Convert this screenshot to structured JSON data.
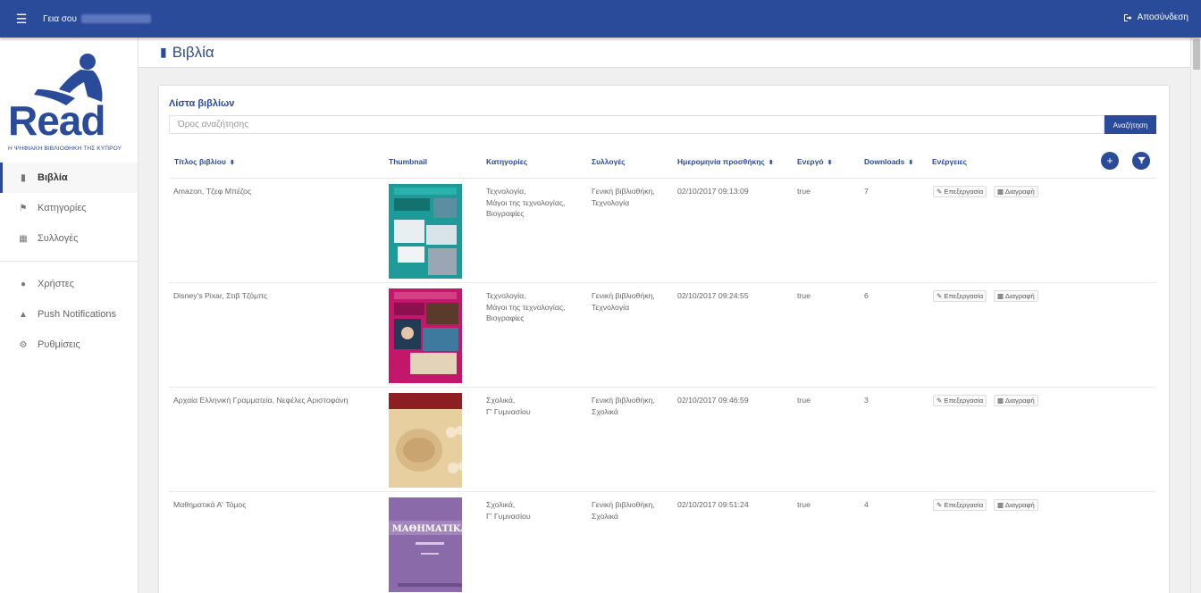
{
  "topbar": {
    "greeting": "Γεια σου",
    "logout_label": "Αποσύνδεση"
  },
  "logo": {
    "word": "Read",
    "subtitle": "Η ΨΗΦΙΑΚΗ ΒΙΒΛΙΟΘΗΚΗ ΤΗΣ ΚΥΠΡΟΥ"
  },
  "sidebar": {
    "items": [
      {
        "label": "Βιβλία",
        "icon": "book-icon"
      },
      {
        "label": "Κατηγορίες",
        "icon": "tags-icon"
      },
      {
        "label": "Συλλογές",
        "icon": "collection-icon"
      },
      {
        "label": "Χρήστες",
        "icon": "users-icon"
      },
      {
        "label": "Push Notifications",
        "icon": "bell-icon"
      },
      {
        "label": "Ρυθμίσεις",
        "icon": "gear-icon"
      }
    ]
  },
  "page": {
    "title": "Βιβλία"
  },
  "card": {
    "title": "Λίστα βιβλίων",
    "search_placeholder": "Όρος αναζήτησης",
    "search_button": "Αναζήτηση"
  },
  "table": {
    "columns": [
      "Τίτλος βιβλίου",
      "Thumbnail",
      "Κατηγορίες",
      "Συλλογές",
      "Ημερομηνία προσθήκης",
      "Ενεργό",
      "Downloads",
      "Ενέργειες"
    ],
    "edit_label": "Επεξεργασία",
    "delete_label": "Διαγραφή",
    "rows": [
      {
        "title": "Amazon, Τζεφ Μπέζος",
        "categories": [
          "Τεχνολογία,",
          "Μάγοι της τεχνολογίας,",
          "Βιογραφίες"
        ],
        "collections": [
          "Γενική βιβλιοθήκη,",
          "Τεχνολογία"
        ],
        "date": "02/10/2017 09:13:09",
        "active": "true",
        "downloads": "7",
        "thumb_color": "#1e9a98"
      },
      {
        "title": "Disney's Pixar, Στιβ Τζόμπς",
        "categories": [
          "Τεχνολογία,",
          "Μάγοι της τεχνολογίας,",
          "Βιογραφίες"
        ],
        "collections": [
          "Γενική βιβλιοθήκη,",
          "Τεχνολογία"
        ],
        "date": "02/10/2017 09:24:55",
        "active": "true",
        "downloads": "6",
        "thumb_color": "#c2176a"
      },
      {
        "title": "Αρχαία Ελληνική Γραμματεία, Νεφέλες Αριστοφάνη",
        "categories": [
          "Σχολικά,",
          "Γ' Γυμνασίου"
        ],
        "collections": [
          "Γενική βιβλιοθήκη,",
          "Σχολικά"
        ],
        "date": "02/10/2017 09:46:59",
        "active": "true",
        "downloads": "3",
        "thumb_color": "#e8cfa0"
      },
      {
        "title": "Μαθηματικά Α' Τόμος",
        "categories": [
          "Σχολικά,",
          "Γ' Γυμνασίου"
        ],
        "collections": [
          "Γενική βιβλιοθήκη,",
          "Σχολικά"
        ],
        "date": "02/10/2017 09:51:24",
        "active": "true",
        "downloads": "4",
        "thumb_color": "#8a6aa8"
      }
    ]
  }
}
